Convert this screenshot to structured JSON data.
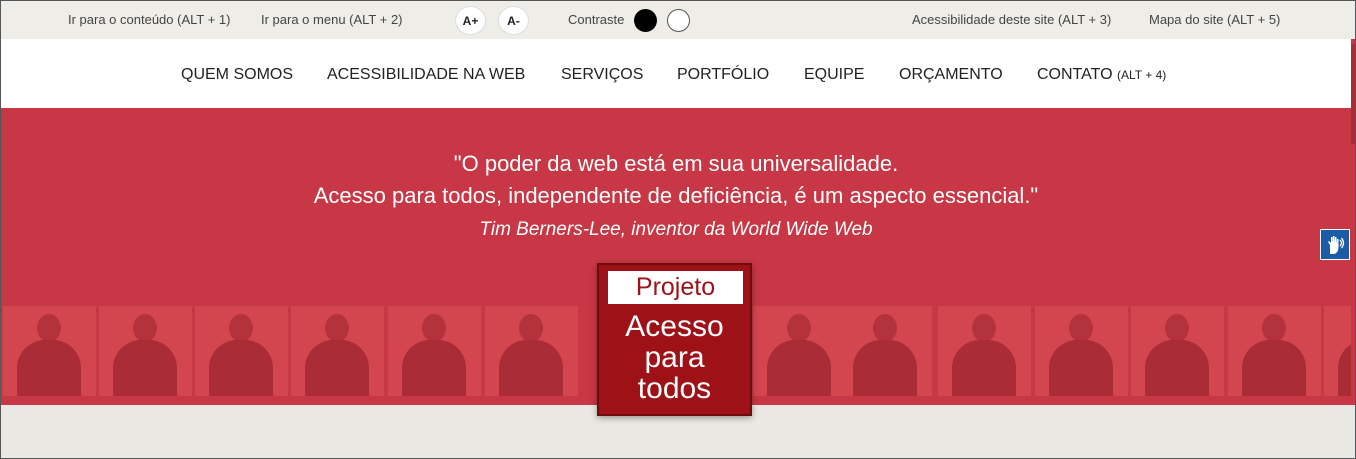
{
  "topbar": {
    "skip_content": "Ir para o conteúdo (ALT + 1)",
    "skip_menu": "Ir para o menu (ALT + 2)",
    "font_increase": "A+",
    "font_decrease": "A-",
    "contrast_label": "Contraste",
    "accessibility": "Acessibilidade deste site (ALT + 3)",
    "sitemap": "Mapa do site (ALT + 5)"
  },
  "menu": {
    "items": [
      "QUEM SOMOS",
      "ACESSIBILIDADE NA WEB",
      "SERVIÇOS",
      "PORTFÓLIO",
      "EQUIPE",
      "ORÇAMENTO"
    ],
    "contact_label": "CONTATO",
    "contact_shortcut": "(ALT + 4)"
  },
  "hero": {
    "quote_line1": "\"O poder da web está em sua universalidade.",
    "quote_line2": "Acesso para todos, independente de deficiência, é um aspecto essencial.\"",
    "author": "Tim Berners-Lee, inventor da World Wide Web"
  },
  "logo": {
    "top": "Projeto",
    "line1": "Acesso",
    "line2": "para",
    "line3": "todos"
  },
  "colors": {
    "hero_red": "#c83745",
    "logo_red": "#9e1117",
    "libras_blue": "#1c5ba8"
  },
  "icons": {
    "libras": "sign-language-hand-icon"
  }
}
